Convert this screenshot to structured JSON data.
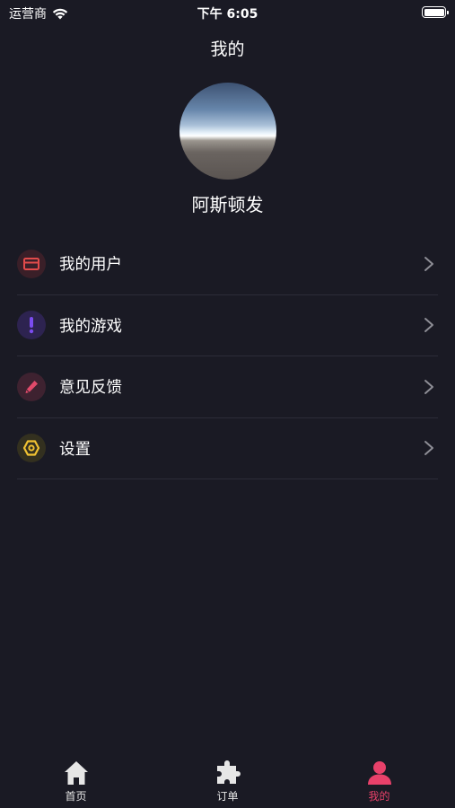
{
  "status_bar": {
    "carrier": "运营商",
    "time": "下午 6:05",
    "battery_level": 1.0
  },
  "header": {
    "title": "我的"
  },
  "profile": {
    "username": "阿斯顿发"
  },
  "menu": [
    {
      "label": "我的用户",
      "icon": "card-icon",
      "icon_color": "#e24b4b"
    },
    {
      "label": "我的游戏",
      "icon": "exclamation-icon",
      "icon_color": "#7b4cf0"
    },
    {
      "label": "意见反馈",
      "icon": "pencil-icon",
      "icon_color": "#e14a6a"
    },
    {
      "label": "设置",
      "icon": "hexagon-icon",
      "icon_color": "#f1c232"
    }
  ],
  "tabs": [
    {
      "label": "首页",
      "icon": "home-icon",
      "active": false
    },
    {
      "label": "订单",
      "icon": "puzzle-icon",
      "active": false
    },
    {
      "label": "我的",
      "icon": "person-icon",
      "active": true
    }
  ],
  "colors": {
    "background": "#1a1a24",
    "accent": "#e8416a",
    "divider": "#2c2c38"
  }
}
